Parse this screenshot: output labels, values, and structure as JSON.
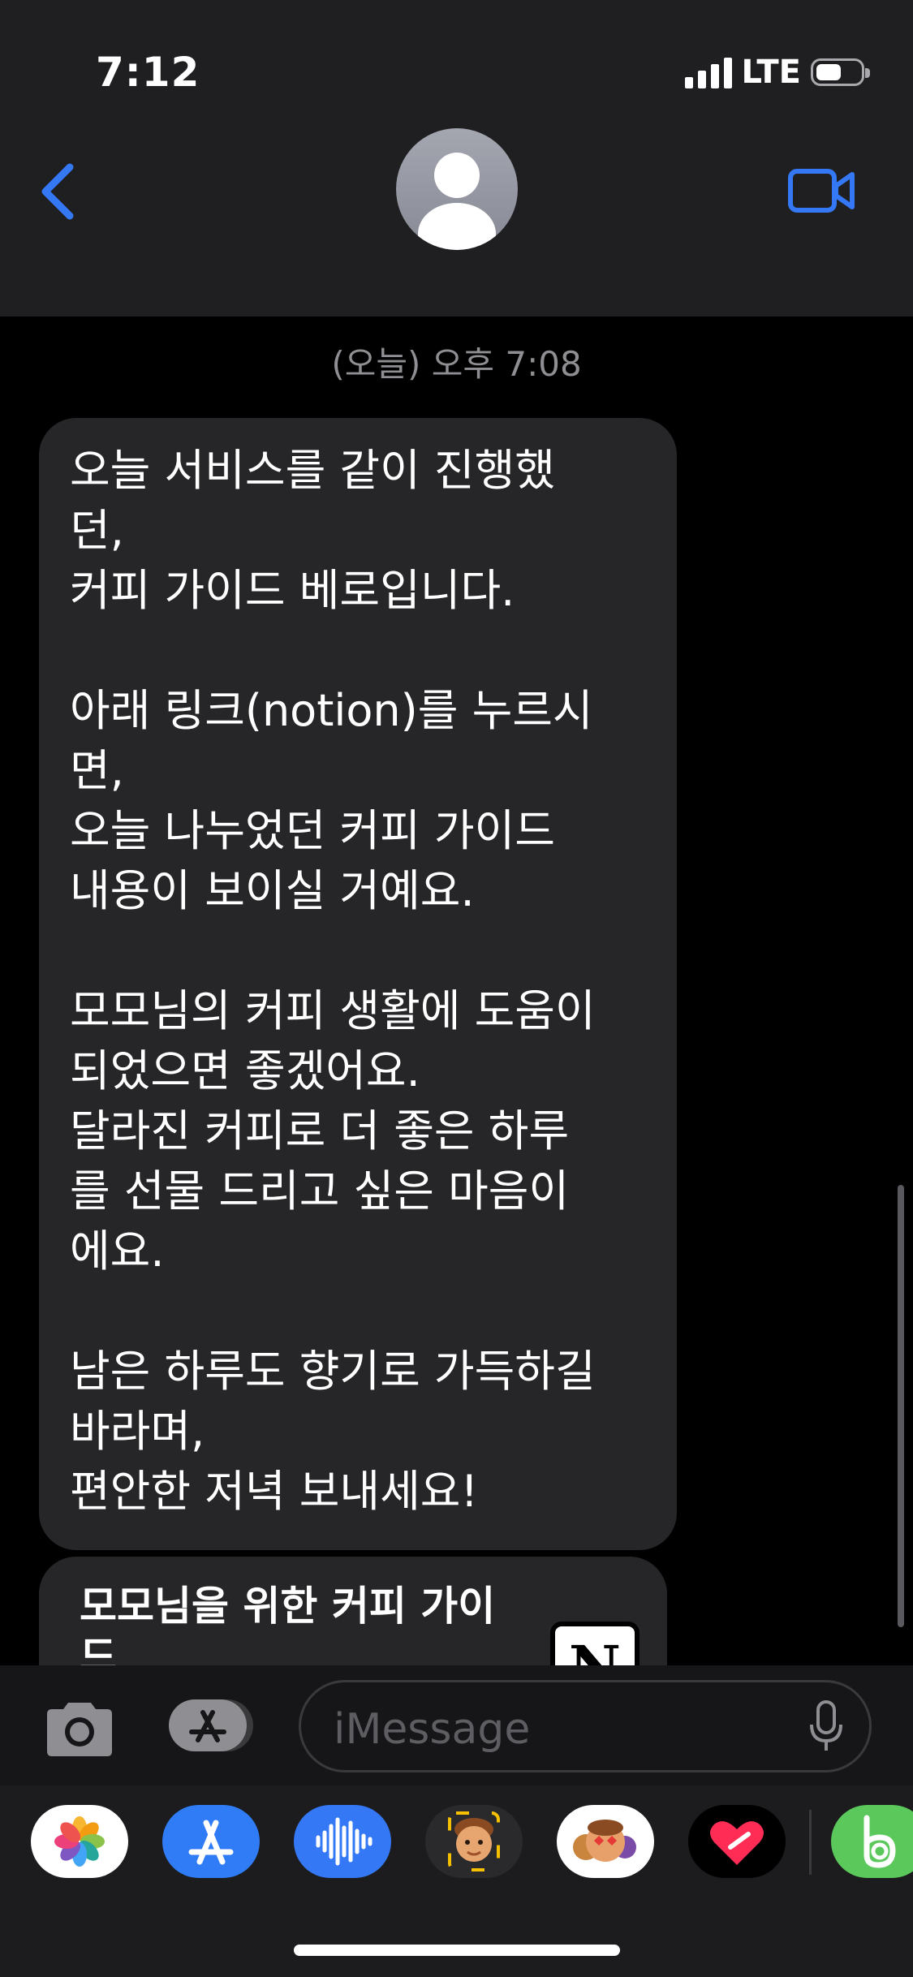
{
  "status_bar": {
    "time": "7:12",
    "network": "LTE"
  },
  "conversation": {
    "timestamp": "(오늘) 오후 7:08",
    "message_text": "오늘 서비스를 같이 진행했\n던,\n커피 가이드 베로입니다.\n\n아래 링크(notion)를 누르시\n면,\n오늘 나누었던 커피 가이드\n내용이 보이실 거예요.\n\n모모님의 커피 생활에 도움이\n되었으면 좋겠어요.\n달라진 커피로 더 좋은 하루\n를 선물 드리고 싶은 마음이\n에요.\n\n남은 하루도 향기로 가득하길\n바라며,\n편안한 저녁 보내세요!",
    "link_preview_title": "모모님을 위한 커피 가이\n드",
    "link_preview_icon": "notion-logo-icon"
  },
  "input": {
    "placeholder": "iMessage"
  },
  "app_drawer": [
    "photos-app-icon",
    "app-store-app-icon",
    "audio-message-app-icon",
    "memoji-camera-app-icon",
    "memoji-stickers-app-icon",
    "digital-touch-app-icon",
    "green-b-app-icon"
  ],
  "colors": {
    "accent": "#3478f6",
    "bubble": "#262628",
    "header": "#1f1f21"
  }
}
